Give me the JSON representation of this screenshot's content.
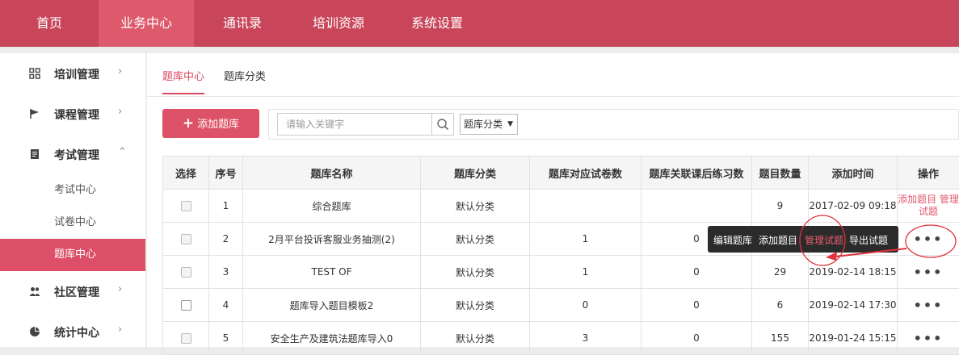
{
  "nav": {
    "items": [
      {
        "label": "首页"
      },
      {
        "label": "业务中心"
      },
      {
        "label": "通讯录"
      },
      {
        "label": "培训资源"
      },
      {
        "label": "系统设置"
      }
    ]
  },
  "sidebar": {
    "groups": [
      {
        "label": "培训管理",
        "icon": "grid-icon",
        "chevron": "›"
      },
      {
        "label": "课程管理",
        "icon": "flag-icon",
        "chevron": "›"
      },
      {
        "label": "考试管理",
        "icon": "document-icon",
        "chevron": "⌃"
      },
      {
        "label": "社区管理",
        "icon": "users-icon",
        "chevron": "›"
      },
      {
        "label": "统计中心",
        "icon": "pie-chart-icon",
        "chevron": "›"
      }
    ],
    "exam_subitems": [
      {
        "label": "考试中心"
      },
      {
        "label": "试卷中心"
      },
      {
        "label": "题库中心"
      }
    ]
  },
  "tabs": [
    {
      "label": "题库中心"
    },
    {
      "label": "题库分类"
    }
  ],
  "toolbar": {
    "add_label": "添加题库",
    "search_placeholder": "请输入关键字",
    "category_select": "题库分类"
  },
  "table": {
    "headers": [
      "选择",
      "序号",
      "题库名称",
      "题库分类",
      "题库对应试卷数",
      "题库关联课后练习数",
      "题目数量",
      "添加时间",
      "操作"
    ],
    "rows": [
      {
        "index": "1",
        "name": "综合题库",
        "category": "默认分类",
        "papers": "",
        "exercises": "",
        "count": "9",
        "time": "2017-02-09 09:18",
        "op_add": "添加题目",
        "op_manage": "管理试题"
      },
      {
        "index": "2",
        "name": "2月平台投诉客服业务抽测(2)",
        "category": "默认分类",
        "papers": "1",
        "exercises": "0",
        "count": "",
        "time": "",
        "ops": "•••"
      },
      {
        "index": "3",
        "name": "TEST OF",
        "category": "默认分类",
        "papers": "1",
        "exercises": "0",
        "count": "29",
        "time": "2019-02-14 18:15",
        "ops": "•••"
      },
      {
        "index": "4",
        "name": "题库导入题目模板2",
        "category": "默认分类",
        "papers": "0",
        "exercises": "0",
        "count": "6",
        "time": "2019-02-14 17:30",
        "ops": "•••"
      },
      {
        "index": "5",
        "name": "安全生产及建筑法题库导入0",
        "category": "默认分类",
        "papers": "3",
        "exercises": "0",
        "count": "155",
        "time": "2019-01-24 15:15",
        "ops": "•••"
      }
    ]
  },
  "popup": {
    "items": [
      {
        "label": "编辑题库"
      },
      {
        "label": "添加题目"
      },
      {
        "label": "管理试题"
      },
      {
        "label": "导出试题"
      }
    ]
  },
  "colors": {
    "brand": "#c8455a",
    "active": "#dd4f66",
    "link": "#e05a6e",
    "annotation": "#e0323c"
  }
}
